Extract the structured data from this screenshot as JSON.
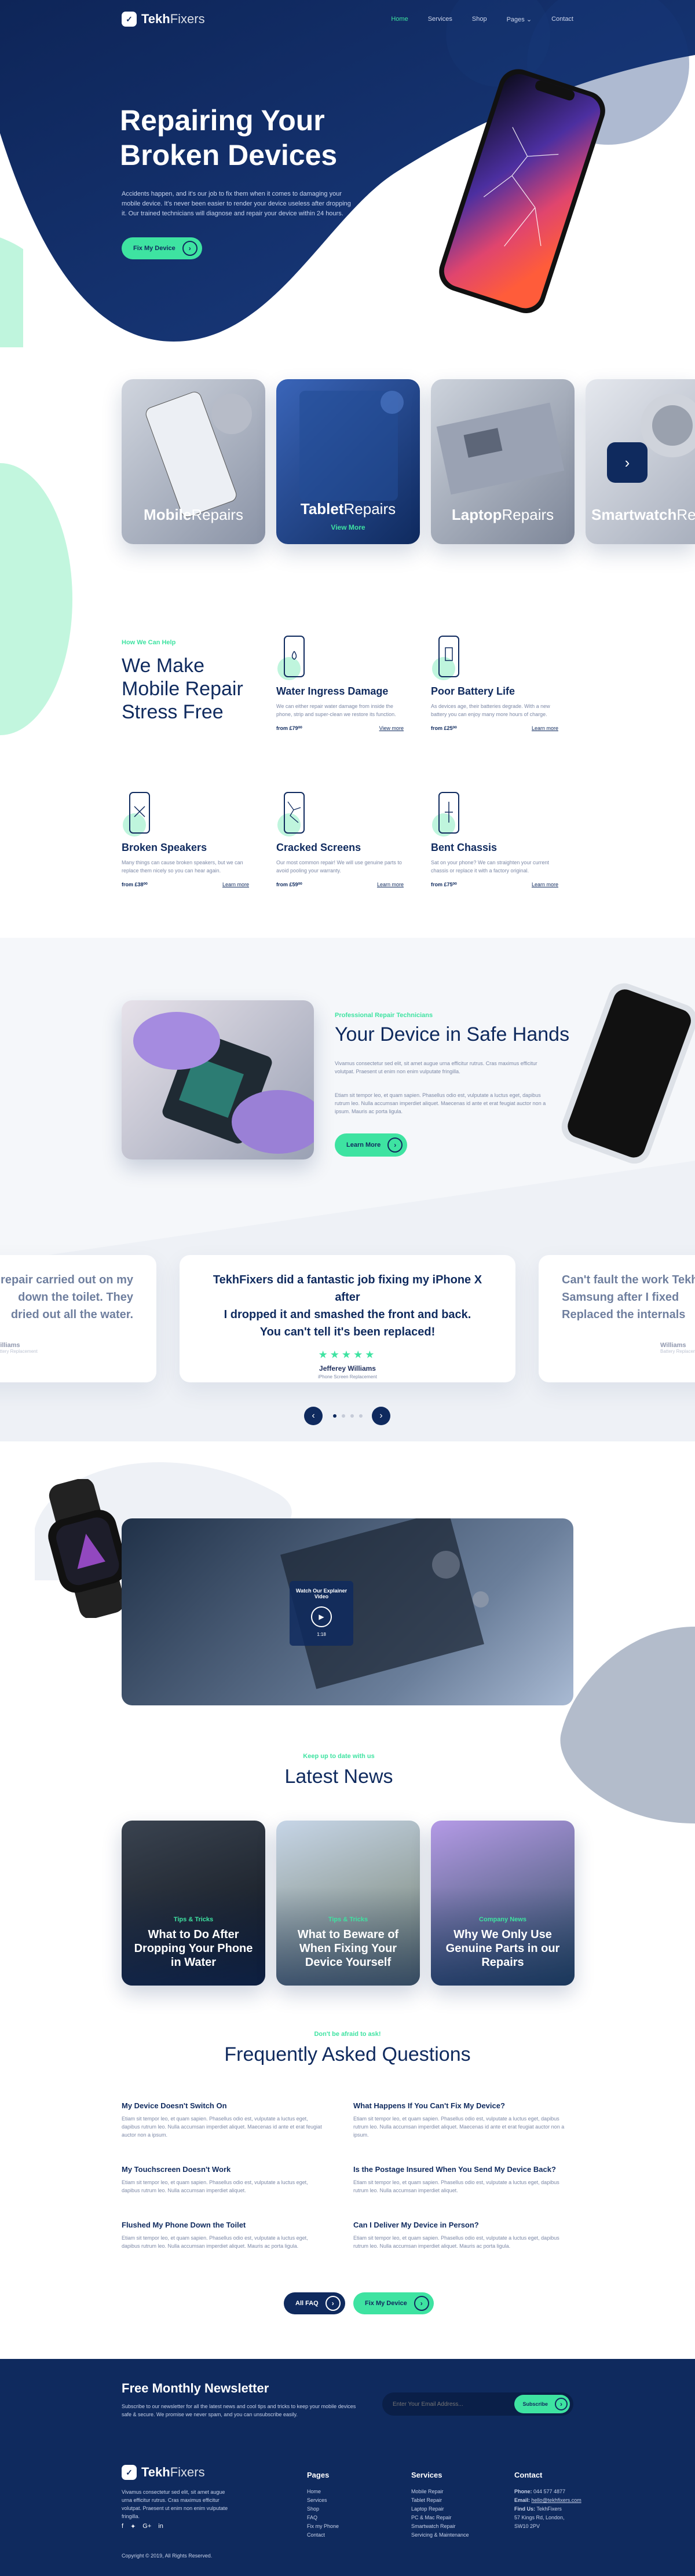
{
  "brand": {
    "name_bold": "Tekh",
    "name_light": "Fixers"
  },
  "nav": {
    "items": [
      "Home",
      "Services",
      "Shop",
      "Pages",
      "Contact"
    ],
    "active": "Home"
  },
  "hero": {
    "title_line1": "Repairing Your",
    "title_line2": "Broken Devices",
    "text": "Accidents happen, and it's our job to fix them when it comes to damaging your mobile device. It's never been easier to render your device useless after dropping it. Our trained technicians will diagnose and repair your device within 24 hours.",
    "cta": "Fix My Device"
  },
  "categories": [
    {
      "bold": "Mobile",
      "light": "Repairs"
    },
    {
      "bold": "Tablet",
      "light": "Repairs",
      "link": "View More"
    },
    {
      "bold": "Laptop",
      "light": "Repairs"
    },
    {
      "bold": "Smartwatch",
      "light": "Repairs"
    }
  ],
  "services": {
    "eyebrow": "How We Can Help",
    "heading_line1": "We Make",
    "heading_line2": "Mobile Repair",
    "heading_line3": "Stress Free",
    "items": [
      {
        "title": "Water Ingress Damage",
        "text": "We can either repair water damage from inside the phone, strip and super-clean we restore its function.",
        "price": "from £79⁰⁰",
        "link": "View more"
      },
      {
        "title": "Poor Battery Life",
        "text": "As devices age, their batteries degrade. With a new battery you can enjoy many more hours of charge.",
        "price": "from £25⁰⁰",
        "link": "Learn more"
      },
      {
        "title": "Broken Speakers",
        "text": "Many things can cause broken speakers, but we can replace them nicely so you can hear again.",
        "price": "from £38⁰⁰",
        "link": "Learn more"
      },
      {
        "title": "Cracked Screens",
        "text": "Our most common repair! We will use genuine parts to avoid pooling your warranty.",
        "price": "from £59⁰⁰",
        "link": "Learn more"
      },
      {
        "title": "Bent Chassis",
        "text": "Sat on your phone? We can straighten your current chassis or replace it with a factory original.",
        "price": "from £75⁰⁰",
        "link": "Learn more"
      }
    ]
  },
  "safe": {
    "eyebrow": "Professional Repair Technicians",
    "heading": "Your Device in Safe Hands",
    "text1": "Vivamus consectetur sed elit, sit amet augue urna efficitur rutrus. Cras maximus efficitur volutpat. Praesent ut enim non enim vulputate fringilla.",
    "text2": "Etiam sit tempor leo, et quam sapien. Phasellus odio est, vulputate a luctus eget, dapibus rutrum leo. Nulla accumsan imperdiet aliquet. Maecenas id ante et erat feugiat auctor non a ipsum. Mauris ac porta ligula.",
    "cta": "Learn More"
  },
  "testimonials": {
    "left": {
      "quote_line1": "repair carried out on my",
      "quote_line2": "down the toilet. They",
      "quote_line3": "dried out all the water.",
      "name": "Williams",
      "role": "Battery Replacement"
    },
    "center": {
      "quote_line1": "TekhFixers did a fantastic job fixing my iPhone X after",
      "quote_line2": "I dropped it and smashed the front and back.",
      "quote_line3": "You can't tell it's been replaced!",
      "name": "Jefferey Williams",
      "role": "iPhone Screen Replacement"
    },
    "right": {
      "quote_line1": "Can't fault the work Tekh",
      "quote_line2": "Samsung after I fixed",
      "quote_line3": "Replaced the internals",
      "name": "Williams",
      "role": "Battery Replacement"
    },
    "stars": "★★★★★"
  },
  "video": {
    "label": "Watch Our Explainer Video",
    "duration": "1:18"
  },
  "news": {
    "eyebrow": "Keep up to date with us",
    "heading": "Latest News",
    "items": [
      {
        "cat": "Tips & Tricks",
        "title": "What to Do After Dropping Your Phone in Water"
      },
      {
        "cat": "Tips & Tricks",
        "title": "What to Beware of When Fixing Your Device Yourself"
      },
      {
        "cat": "Company News",
        "title": "Why We Only Use Genuine Parts in our Repairs"
      }
    ]
  },
  "faq": {
    "eyebrow": "Don't be afraid to ask!",
    "heading": "Frequently Asked Questions",
    "items": [
      {
        "q": "My Device Doesn't Switch On",
        "a": "Etiam sit tempor leo, et quam sapien. Phasellus odio est, vulputate a luctus eget, dapibus rutrum leo. Nulla accumsan imperdiet aliquet. Maecenas id ante et erat feugiat auctor non a ipsum."
      },
      {
        "q": "What Happens If You Can't Fix My Device?",
        "a": "Etiam sit tempor leo, et quam sapien. Phasellus odio est, vulputate a luctus eget, dapibus rutrum leo. Nulla accumsan imperdiet aliquet. Maecenas id ante et erat feugiat auctor non a ipsum."
      },
      {
        "q": "My Touchscreen Doesn't Work",
        "a": "Etiam sit tempor leo, et quam sapien. Phasellus odio est, vulputate a luctus eget, dapibus rutrum leo. Nulla accumsan imperdiet aliquet."
      },
      {
        "q": "Is the Postage Insured When You Send My Device Back?",
        "a": "Etiam sit tempor leo, et quam sapien. Phasellus odio est, vulputate a luctus eget, dapibus rutrum leo. Nulla accumsan imperdiet aliquet."
      },
      {
        "q": "Flushed My Phone Down the Toilet",
        "a": "Etiam sit tempor leo, et quam sapien. Phasellus odio est, vulputate a luctus eget, dapibus rutrum leo. Nulla accumsan imperdiet aliquet. Mauris ac porta ligula."
      },
      {
        "q": "Can I Deliver My Device in Person?",
        "a": "Etiam sit tempor leo, et quam sapien. Phasellus odio est, vulputate a luctus eget, dapibus rutrum leo. Nulla accumsan imperdiet aliquet. Mauris ac porta ligula."
      }
    ],
    "btn_all": "All FAQ",
    "btn_fix": "Fix My Device"
  },
  "newsletter": {
    "title": "Free Monthly Newsletter",
    "text": "Subscribe to our newsletter for all the latest news and cool tips and tricks to keep your mobile devices safe & secure. We promise we never spam, and you can unsubscribe easily.",
    "placeholder": "Enter Your Email Address...",
    "btn": "Subscribe"
  },
  "footer": {
    "about": "Vivamus consectetur sed elit, sit amet augue urna efficitur rutrus. Cras maximus efficitur volutpat. Praesent ut enim non enim vulputate fringilla.",
    "pages_title": "Pages",
    "pages": [
      "Home",
      "Services",
      "Shop",
      "FAQ",
      "Fix my Phone",
      "Contact"
    ],
    "services_title": "Services",
    "services": [
      "Mobile Repair",
      "Tablet Repair",
      "Laptop Repair",
      "PC & Mac Repair",
      "Smartwatch Repair",
      "Servicing & Maintenance"
    ],
    "contact_title": "Contact",
    "phone_label": "Phone:",
    "phone": "044 577 4877",
    "email_label": "Email:",
    "email": "hello@tekhfixers.com",
    "find_label": "Find Us:",
    "addr1": "TekhFixers",
    "addr2": "57 Kings Rd, London,",
    "addr3": "SW10 2PV",
    "copyright": "Copyright © 2019, All Rights Reserved."
  },
  "colors": {
    "navy": "#0f2a5e",
    "green": "#3ee3a1"
  }
}
